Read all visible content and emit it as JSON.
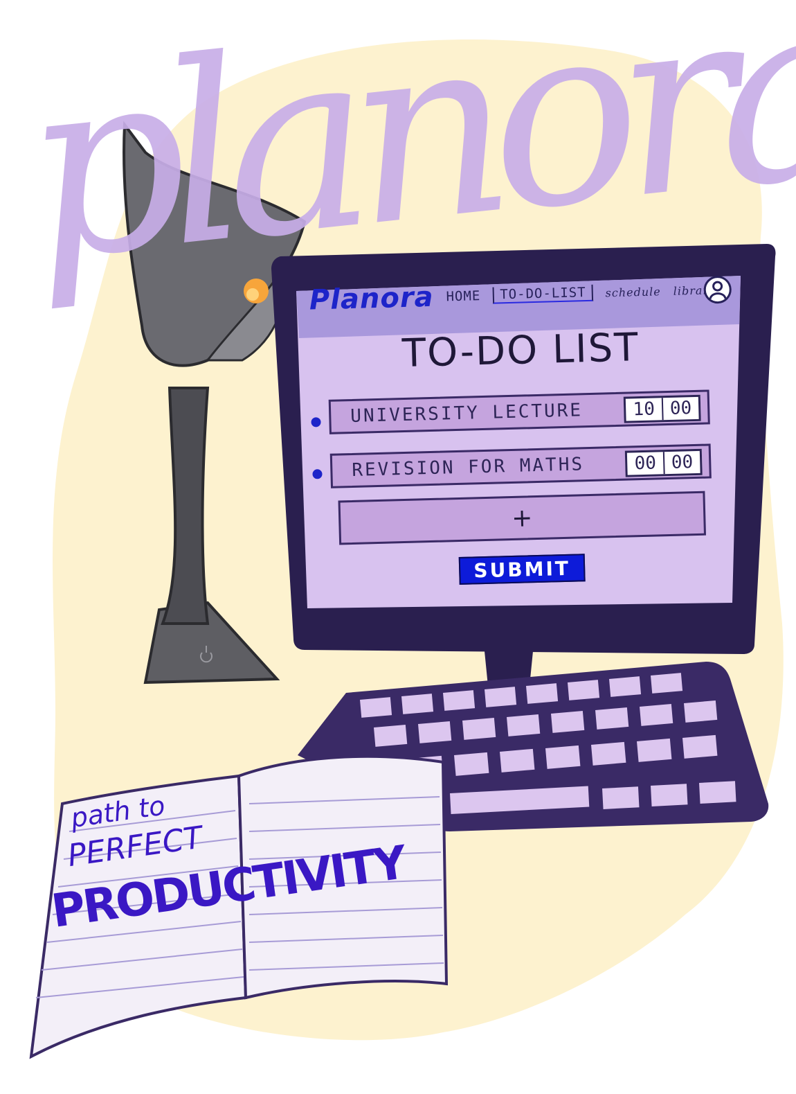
{
  "brand_big": "planora",
  "nav": {
    "brand": "Planora",
    "links": [
      "HOME",
      "TO-DO-LIST",
      "schedule",
      "library"
    ]
  },
  "todo": {
    "title": "TO-DO LIST",
    "tasks": [
      {
        "text": "UNIVERSITY LECTURE",
        "hours": "10",
        "minutes": "00"
      },
      {
        "text": "REVISION FOR MATHS",
        "hours": "00",
        "minutes": "00"
      }
    ],
    "add_label": "+",
    "submit_label": "SUBMIT"
  },
  "notebook": {
    "line1": "path to",
    "line2": "PERFECT",
    "line3": "PRODUCTIVITY"
  },
  "colors": {
    "background_blob": "#fdf2cf",
    "lavender": "#c8aee8",
    "screen": "#d8c2ef",
    "navbar": "#a998dc",
    "frame": "#2a1f4f",
    "accent_blue": "#1d24c9",
    "lamp_gray": "#55555b"
  },
  "icons": [
    "user-avatar-icon",
    "power-icon",
    "desk-lamp",
    "keyboard",
    "notebook"
  ]
}
